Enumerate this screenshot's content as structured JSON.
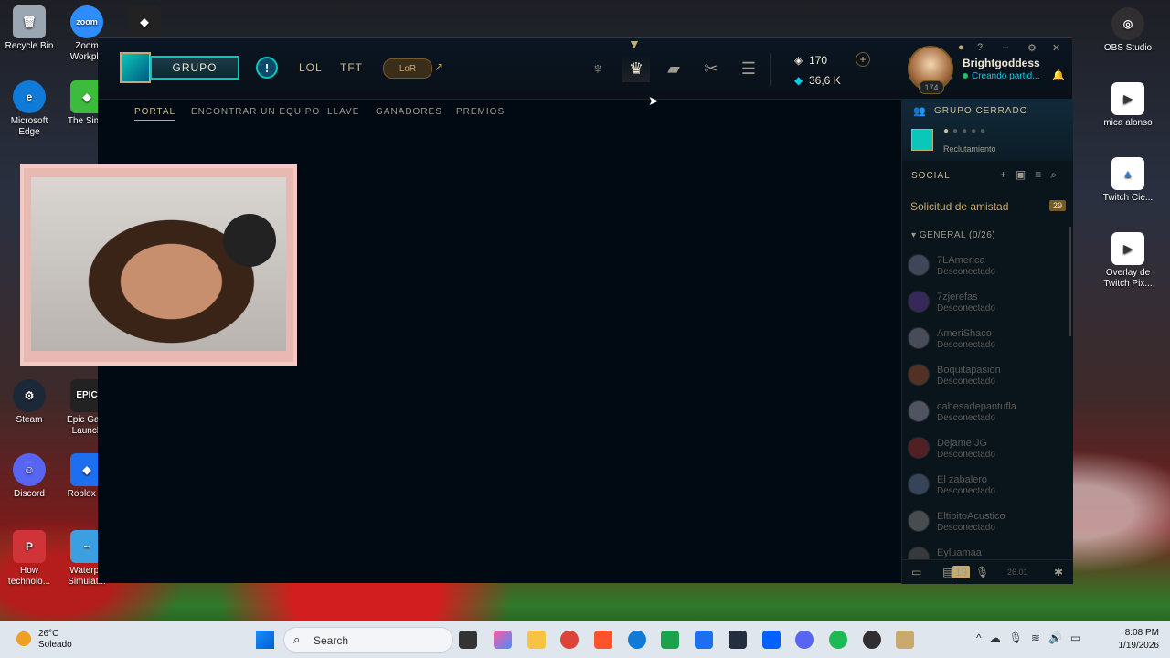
{
  "desktop": {
    "left_icons": [
      {
        "label": "Recycle Bin",
        "color": "#9aa6b2"
      },
      {
        "label": "Zoom Workpla",
        "color": "#2d8cff"
      },
      {
        "label": "",
        "color": "#222222"
      },
      {
        "label": "Microsoft Edge",
        "color": "#0f7ad8"
      },
      {
        "label": "The Sims",
        "color": "#3dbb3d"
      },
      {
        "label": "Steam",
        "color": "#1b2838"
      },
      {
        "label": "Epic Gam Launch",
        "color": "#222222"
      },
      {
        "label": "Discord",
        "color": "#5865f2"
      },
      {
        "label": "Roblox Pl",
        "color": "#1e6ff0"
      },
      {
        "label": "How technolo...",
        "color": "#d13438"
      },
      {
        "label": "Waterpa Simulat...",
        "color": "#3aa0e0"
      }
    ],
    "right_icons": [
      {
        "label": "OBS Studio"
      },
      {
        "label": "mica alonso"
      },
      {
        "label": "Twitch Cie..."
      },
      {
        "label": "Overlay de Twitch Pix..."
      }
    ]
  },
  "client": {
    "grupo_label": "GRUPO",
    "alert_symbol": "!",
    "nav_lol": "LOL",
    "nav_tft": "TFT",
    "nav_lor": "LoR",
    "external_arrow": "↗",
    "nav_icons": [
      "tft-icon",
      "clash-icon",
      "collection-icon",
      "loot-icon",
      "store-icon"
    ],
    "rp": "170",
    "be": "36,6 K",
    "currency_plus": "+",
    "window_controls": [
      "?",
      "–",
      "⚙",
      "✕"
    ],
    "profile": {
      "name": "Brightgoddess",
      "status": "Creando partid...",
      "level": "174"
    },
    "subnav": [
      {
        "label": "PORTAL",
        "active": true
      },
      {
        "label": "ENCONTRAR UN EQUIPO",
        "active": false
      },
      {
        "label": "LLAVE",
        "active": false
      },
      {
        "label": "GANADORES",
        "active": false
      },
      {
        "label": "PREMIOS",
        "active": false
      }
    ]
  },
  "social": {
    "group_title": "GRUPO CERRADO",
    "group_recruit": "Reclutamiento",
    "header": "SOCIAL",
    "friend_request_label": "Solicitud de amistad",
    "friend_request_count": "29",
    "general_label": "GENERAL (0/26)",
    "friends": [
      {
        "name": "7LAmerica",
        "status": "Desconectado",
        "color": "#6a6f8a"
      },
      {
        "name": "7zjerefas",
        "status": "Desconectado",
        "color": "#5a3a8a"
      },
      {
        "name": "AmeriShaco",
        "status": "Desconectado",
        "color": "#7a7a8a"
      },
      {
        "name": "Boquitapasion",
        "status": "Desconectado",
        "color": "#8a4a2a"
      },
      {
        "name": "cabesadepantufla",
        "status": "Desconectado",
        "color": "#8a8a9a"
      },
      {
        "name": "Dejame JG",
        "status": "Desconectado",
        "color": "#8a2a2a"
      },
      {
        "name": "El zabalero",
        "status": "Desconectado",
        "color": "#5a6a8a"
      },
      {
        "name": "EltipitoAcustico",
        "status": "Desconectado",
        "color": "#7a7a7a"
      },
      {
        "name": "Eyluamaa",
        "status": "",
        "color": "#5a5a5a"
      }
    ],
    "footer_badge": "19",
    "footer_version": "26.01"
  },
  "taskbar": {
    "temp": "26°C",
    "weather": "Soleado",
    "search_placeholder": "Search",
    "time": "8:08 PM",
    "date": "1/19/2026"
  }
}
